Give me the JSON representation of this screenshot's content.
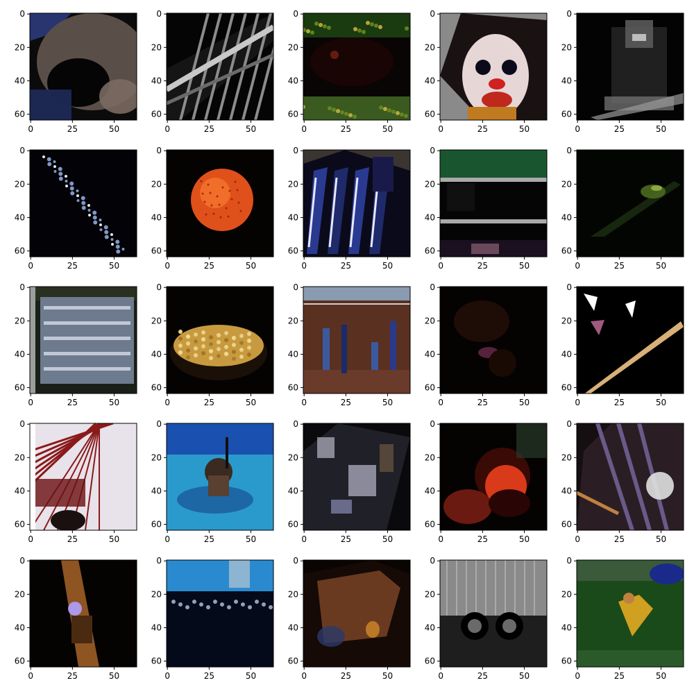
{
  "figure": {
    "grid": {
      "rows": 5,
      "cols": 5
    },
    "tick_labels": {
      "x": [
        "0",
        "25",
        "50"
      ],
      "y": [
        "0",
        "20",
        "40",
        "60"
      ]
    },
    "colors": {
      "axes_edge": "#000000",
      "background": "#ffffff"
    },
    "panels": [
      {
        "subject": "close-up animal face",
        "bg": "#0b0b0b",
        "tone": "#5a4e48",
        "accent": "#2c3a7a",
        "style": "blob-tl"
      },
      {
        "subject": "diagonal railing",
        "bg": "#050505",
        "tone": "#8c8c8c",
        "accent": "#c8c8c8",
        "style": "stripes"
      },
      {
        "subject": "dark scene with foliage",
        "bg": "#0a0505",
        "tone": "#3a6b1a",
        "accent": "#6b2010",
        "style": "foliage"
      },
      {
        "subject": "clown face",
        "bg": "#3a2a22",
        "tone": "#e6d6d6",
        "accent": "#c0281e",
        "style": "face"
      },
      {
        "subject": "dark grey object",
        "bg": "#030303",
        "tone": "#6e6e6e",
        "accent": "#bdbdbd",
        "style": "dark-object"
      },
      {
        "subject": "diagonal light streak",
        "bg": "#020207",
        "tone": "#8fa7d8",
        "accent": "#ffffff",
        "style": "streak"
      },
      {
        "subject": "orange fruit",
        "bg": "#050202",
        "tone": "#e0501a",
        "accent": "#ff8a3a",
        "style": "orange"
      },
      {
        "subject": "blue striped objects",
        "bg": "#3a3530",
        "tone": "#1f2a6a",
        "accent": "#e8e8ff",
        "style": "blue-stripes"
      },
      {
        "subject": "shelves",
        "bg": "#050505",
        "tone": "#1e6a3a",
        "accent": "#aaaaaa",
        "style": "shelves"
      },
      {
        "subject": "dark with green sprout",
        "bg": "#030503",
        "tone": "#4a6a20",
        "accent": "#8aa840",
        "style": "sprout"
      },
      {
        "subject": "grey sign board",
        "bg": "#1a2018",
        "tone": "#6e7a8e",
        "accent": "#c9d0e0",
        "style": "board"
      },
      {
        "subject": "bowl of snacks",
        "bg": "#050302",
        "tone": "#c89a40",
        "accent": "#f0d890",
        "style": "snacks"
      },
      {
        "subject": "people on court",
        "bg": "#2a2e3a",
        "tone": "#5a3020",
        "accent": "#3a5aa0",
        "style": "court"
      },
      {
        "subject": "very dark scene",
        "bg": "#050202",
        "tone": "#2a1208",
        "accent": "#6a2a4a",
        "style": "very-dark"
      },
      {
        "subject": "stick and shapes",
        "bg": "#000000",
        "tone": "#d8b078",
        "accent": "#ffffff",
        "style": "stick"
      },
      {
        "subject": "red frame structure",
        "bg": "#e8e2ea",
        "tone": "#8a1a1a",
        "accent": "#1a1010",
        "style": "red-frame"
      },
      {
        "subject": "snorkeler in water",
        "bg": "#1a50b0",
        "tone": "#2a9acc",
        "accent": "#3a2a20",
        "style": "snorkeler"
      },
      {
        "subject": "scattered objects",
        "bg": "#0a0a0c",
        "tone": "#8a8a9a",
        "accent": "#d0d0e0",
        "style": "scatter"
      },
      {
        "subject": "tomato close-up",
        "bg": "#050202",
        "tone": "#d83a1a",
        "accent": "#6a1a10",
        "style": "tomato"
      },
      {
        "subject": "bicycle parts",
        "bg": "#150f12",
        "tone": "#6a5a8a",
        "accent": "#e0e0e0",
        "style": "bike"
      },
      {
        "subject": "wrist watch",
        "bg": "#050302",
        "tone": "#b06a2a",
        "accent": "#b0a0ff",
        "style": "watch"
      },
      {
        "subject": "sky over dark ground",
        "bg": "#070a15",
        "tone": "#2a8ad0",
        "accent": "#d0e0ff",
        "style": "sky"
      },
      {
        "subject": "brown box",
        "bg": "#0a0502",
        "tone": "#6a3a20",
        "accent": "#2a3a6a",
        "style": "box"
      },
      {
        "subject": "graffiti train",
        "bg": "#060606",
        "tone": "#8a8a8a",
        "accent": "#1e1e1e",
        "style": "train"
      },
      {
        "subject": "person on grass",
        "bg": "#0a1a0a",
        "tone": "#1a4a1a",
        "accent": "#d0a020",
        "style": "grass"
      }
    ]
  }
}
